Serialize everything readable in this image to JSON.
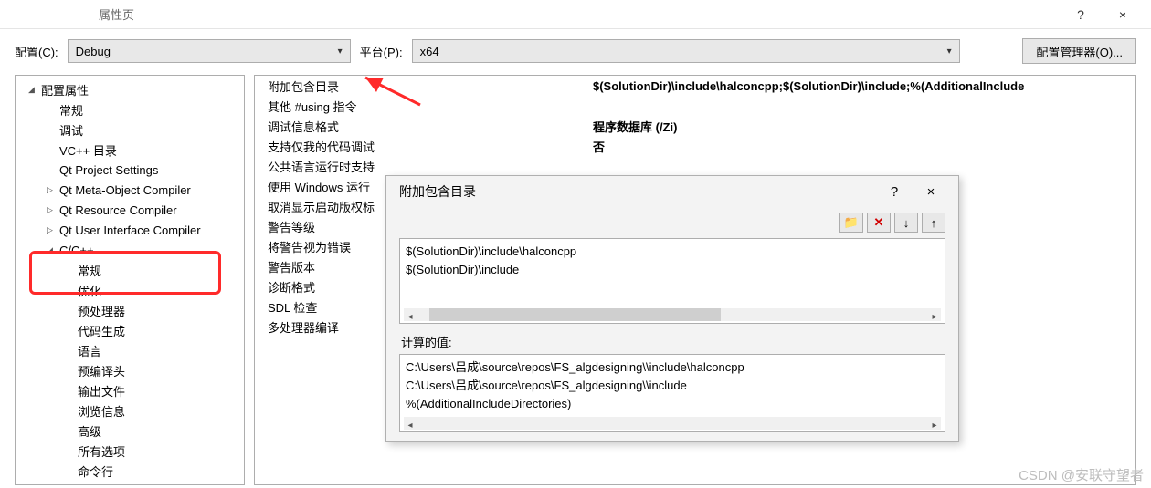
{
  "window": {
    "title_suffix": "属性页",
    "help": "?",
    "close": "×"
  },
  "toolbar": {
    "config_label": "配置(C):",
    "config_value": "Debug",
    "platform_label": "平台(P):",
    "platform_value": "x64",
    "manager_button": "配置管理器(O)..."
  },
  "tree": {
    "root": "配置属性",
    "items": [
      {
        "label": "常规",
        "depth": 2
      },
      {
        "label": "调试",
        "depth": 2
      },
      {
        "label": "VC++ 目录",
        "depth": 2
      },
      {
        "label": "Qt Project Settings",
        "depth": 2
      },
      {
        "label": "Qt Meta-Object Compiler",
        "depth": 2,
        "expandable": true
      },
      {
        "label": "Qt Resource Compiler",
        "depth": 2,
        "expandable": true
      },
      {
        "label": "Qt User Interface Compiler",
        "depth": 2,
        "expandable": true
      },
      {
        "label": "C/C++",
        "depth": 2,
        "expandable": true,
        "expanded": true
      },
      {
        "label": "常规",
        "depth": 3,
        "selected": true
      },
      {
        "label": "优化",
        "depth": 3
      },
      {
        "label": "预处理器",
        "depth": 3
      },
      {
        "label": "代码生成",
        "depth": 3
      },
      {
        "label": "语言",
        "depth": 3
      },
      {
        "label": "预编译头",
        "depth": 3
      },
      {
        "label": "输出文件",
        "depth": 3
      },
      {
        "label": "浏览信息",
        "depth": 3
      },
      {
        "label": "高级",
        "depth": 3
      },
      {
        "label": "所有选项",
        "depth": 3
      },
      {
        "label": "命令行",
        "depth": 3
      }
    ]
  },
  "props": [
    {
      "name": "附加包含目录",
      "value": "$(SolutionDir)\\include\\halconcpp;$(SolutionDir)\\include;%(AdditionalInclude"
    },
    {
      "name": "其他 #using 指令",
      "value": ""
    },
    {
      "name": "调试信息格式",
      "value": "程序数据库 (/Zi)"
    },
    {
      "name": "支持仅我的代码调试",
      "value": "否"
    },
    {
      "name": "公共语言运行时支持",
      "value": ""
    },
    {
      "name": "使用 Windows 运行",
      "value": ""
    },
    {
      "name": "取消显示启动版权标",
      "value": ""
    },
    {
      "name": "警告等级",
      "value": ""
    },
    {
      "name": "将警告视为错误",
      "value": ""
    },
    {
      "name": "警告版本",
      "value": ""
    },
    {
      "name": "诊断格式",
      "value": ""
    },
    {
      "name": "SDL 检查",
      "value": ""
    },
    {
      "name": "多处理器编译",
      "value": ""
    }
  ],
  "dialog": {
    "title": "附加包含目录",
    "help": "?",
    "close": "×",
    "lines": [
      "$(SolutionDir)\\include\\halconcpp",
      "$(SolutionDir)\\include"
    ],
    "computed_label": "计算的值:",
    "computed_lines": [
      "C:\\Users\\吕成\\source\\repos\\FS_algdesigning\\\\include\\halconcpp",
      "C:\\Users\\吕成\\source\\repos\\FS_algdesigning\\\\include",
      "%(AdditionalIncludeDirectories)"
    ],
    "icons": {
      "new_folder": "new-folder-icon",
      "delete": "delete-icon",
      "move_down": "move-down-icon",
      "move_up": "move-up-icon"
    }
  },
  "watermark": "CSDN @安联守望者"
}
